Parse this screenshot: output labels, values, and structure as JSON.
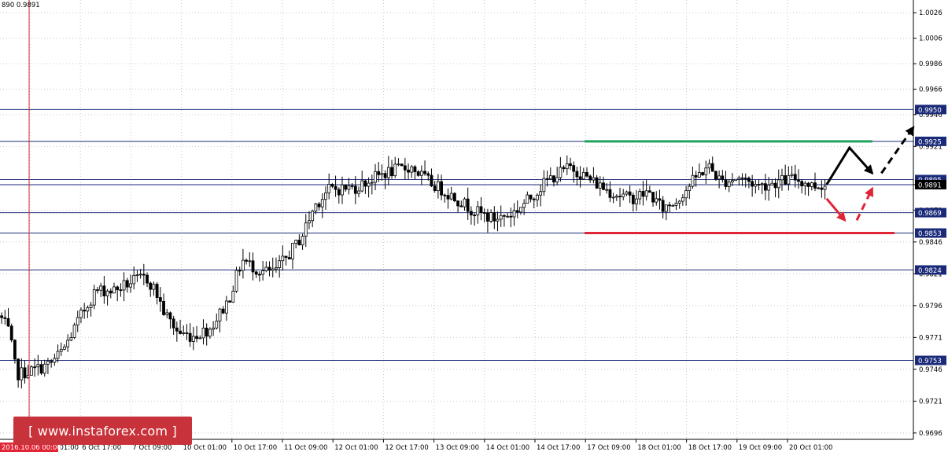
{
  "ohlc_header": "890 0.9891",
  "watermark": "[ www.instaforex.com ]",
  "colors": {
    "background": "#ffffff",
    "grid": "#c8c8c8",
    "candle": "#000000",
    "level_line": "#1a2a78",
    "label_bg": "#1a2a78",
    "resistance": "#1fa35a",
    "support": "#e02536",
    "bullish_arrow": "#000000",
    "bearish_arrow": "#e02536",
    "vertical_marker": "#e02536",
    "watermark_bg": "#c8323a"
  },
  "chart_data": {
    "type": "candlestick",
    "symbol_timeframe": "H1",
    "x_start_label": "2016.10.06 00:00",
    "x_tick_labels": [
      "7 Oct 01:00",
      "6 Oct 17:00",
      "7 Oct 09:00",
      "10 Oct 01:00",
      "10 Oct 17:00",
      "11 Oct 09:00",
      "12 Oct 01:00",
      "12 Oct 17:00",
      "13 Oct 09:00",
      "14 Oct 01:00",
      "14 Oct 17:00",
      "17 Oct 09:00",
      "18 Oct 01:00",
      "18 Oct 17:00",
      "19 Oct 09:00",
      "20 Oct 01:00"
    ],
    "ylim": [
      0.9691,
      1.0036
    ],
    "y_tick_labels": [
      "1.0026",
      "1.0006",
      "0.9986",
      "0.9966",
      "0.9946",
      "0.9921",
      "0.9891",
      "0.9871",
      "0.9846",
      "0.9821",
      "0.9796",
      "0.9771",
      "0.9746",
      "0.9721",
      "0.9696"
    ],
    "y_ticks": [
      1.0026,
      1.0006,
      0.9986,
      0.9966,
      0.9946,
      0.9921,
      0.9891,
      0.9871,
      0.9846,
      0.9821,
      0.9796,
      0.9771,
      0.9746,
      0.9721,
      0.9696
    ],
    "levels": [
      {
        "value": 0.995,
        "label": "0.9950"
      },
      {
        "value": 0.9925,
        "label": "0.9925"
      },
      {
        "value": 0.9895,
        "label": "0.9895"
      },
      {
        "value": 0.9891,
        "label": "0.9891",
        "current": true
      },
      {
        "value": 0.9869,
        "label": "0.9869"
      },
      {
        "value": 0.9853,
        "label": "0.9853"
      },
      {
        "value": 0.9824,
        "label": "0.9824"
      },
      {
        "value": 0.9753,
        "label": "0.9753"
      }
    ],
    "resistance_line": {
      "value": 0.9925,
      "bar_from": 0.64,
      "bar_to": 0.955
    },
    "support_line": {
      "value": 0.9853,
      "bar_from": 0.64,
      "bar_to": 1.005
    },
    "anchors": [
      [
        0.0,
        0.9788
      ],
      [
        0.01,
        0.9775
      ],
      [
        0.018,
        0.9742
      ],
      [
        0.035,
        0.9745
      ],
      [
        0.055,
        0.975
      ],
      [
        0.07,
        0.9762
      ],
      [
        0.09,
        0.979
      ],
      [
        0.105,
        0.9808
      ],
      [
        0.125,
        0.9808
      ],
      [
        0.145,
        0.9815
      ],
      [
        0.16,
        0.9818
      ],
      [
        0.17,
        0.9808
      ],
      [
        0.18,
        0.979
      ],
      [
        0.195,
        0.9775
      ],
      [
        0.21,
        0.9772
      ],
      [
        0.23,
        0.9778
      ],
      [
        0.25,
        0.98
      ],
      [
        0.265,
        0.9832
      ],
      [
        0.285,
        0.9823
      ],
      [
        0.3,
        0.9822
      ],
      [
        0.315,
        0.9835
      ],
      [
        0.33,
        0.985
      ],
      [
        0.345,
        0.9875
      ],
      [
        0.36,
        0.9887
      ],
      [
        0.39,
        0.9889
      ],
      [
        0.42,
        0.99
      ],
      [
        0.45,
        0.9905
      ],
      [
        0.47,
        0.9893
      ],
      [
        0.5,
        0.988
      ],
      [
        0.52,
        0.987
      ],
      [
        0.54,
        0.9864
      ],
      [
        0.56,
        0.9868
      ],
      [
        0.58,
        0.988
      ],
      [
        0.6,
        0.9895
      ],
      [
        0.625,
        0.9905
      ],
      [
        0.65,
        0.9893
      ],
      [
        0.67,
        0.9885
      ],
      [
        0.69,
        0.988
      ],
      [
        0.71,
        0.9885
      ],
      [
        0.725,
        0.9872
      ],
      [
        0.74,
        0.9878
      ],
      [
        0.76,
        0.9895
      ],
      [
        0.775,
        0.9906
      ],
      [
        0.79,
        0.9893
      ],
      [
        0.81,
        0.9897
      ],
      [
        0.83,
        0.989
      ],
      [
        0.85,
        0.9893
      ],
      [
        0.87,
        0.9896
      ],
      [
        0.89,
        0.989
      ],
      [
        0.905,
        0.9891
      ]
    ],
    "forecast_arrows": [
      {
        "type": "bullish",
        "style": "solid",
        "points": [
          [
            0.905,
            0.9891
          ],
          [
            0.93,
            0.992
          ],
          [
            0.955,
            0.99
          ]
        ]
      },
      {
        "type": "bullish",
        "style": "dashed",
        "points": [
          [
            0.965,
            0.99
          ],
          [
            1.0,
            0.9936
          ]
        ]
      },
      {
        "type": "bearish",
        "style": "solid",
        "points": [
          [
            0.905,
            0.988
          ],
          [
            0.925,
            0.9863
          ]
        ]
      },
      {
        "type": "bearish",
        "style": "dashed",
        "points": [
          [
            0.938,
            0.9863
          ],
          [
            0.955,
            0.9888
          ]
        ]
      }
    ]
  }
}
